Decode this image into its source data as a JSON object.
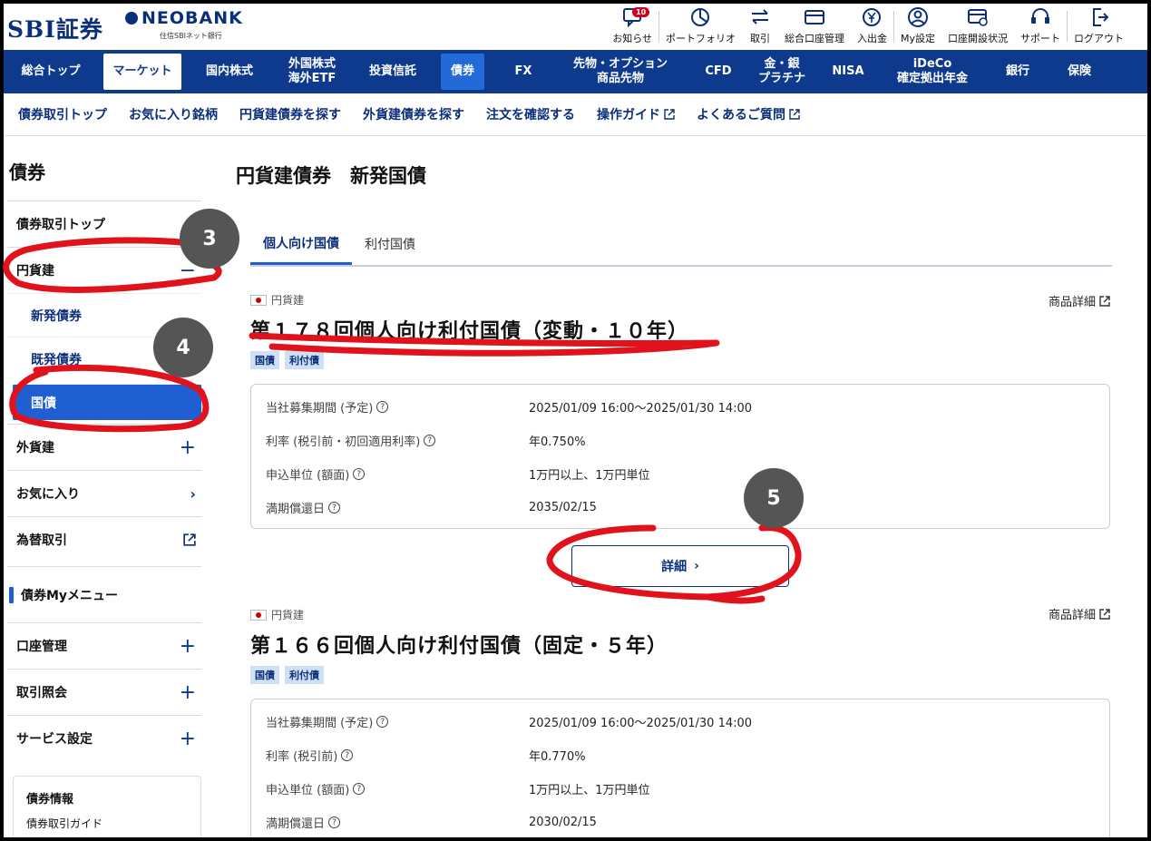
{
  "brand": {
    "sbi": "SBI証券",
    "neobank": "NEOBANK",
    "neobank_sub": "住信SBIネット銀行"
  },
  "topnav": [
    {
      "label": "お知らせ",
      "icon": "message-icon",
      "badge": "10"
    },
    {
      "label": "ポートフォリオ",
      "icon": "pie-chart-icon"
    },
    {
      "label": "取引",
      "icon": "exchange-icon"
    },
    {
      "label": "総合口座管理",
      "icon": "card-icon"
    },
    {
      "label": "入出金",
      "icon": "yen-icon"
    },
    {
      "label": "My設定",
      "icon": "user-icon"
    },
    {
      "label": "口座開設状況",
      "icon": "card-check-icon"
    },
    {
      "label": "サポート",
      "icon": "headset-icon"
    },
    {
      "label": "ログアウト",
      "icon": "logout-icon"
    }
  ],
  "mainnav": [
    "総合トップ",
    "マーケット",
    "国内株式",
    "外国株式\n海外ETF",
    "投資信託",
    "債券",
    "FX",
    "先物・オプション\n商品先物",
    "CFD",
    "金・銀\nプラチナ",
    "NISA",
    "iDeCo\n確定拠出年金",
    "銀行",
    "保険"
  ],
  "subnav": [
    "債券取引トップ",
    "お気に入り銘柄",
    "円貨建債券を探す",
    "外貨建債券を探す",
    "注文を確認する",
    "操作ガイド",
    "よくあるご質問"
  ],
  "sidebar": {
    "title": "債券",
    "top": "債券取引トップ",
    "yen": "円貨建",
    "new_bonds": "新発債券",
    "existing_bonds": "既発債券",
    "jgb": "国債",
    "foreign": "外貨建",
    "favorites": "お気に入り",
    "fx_trade": "為替取引",
    "mymenu": "債券Myメニュー",
    "account": "口座管理",
    "history": "取引照会",
    "service": "サービス設定",
    "info_title": "債券情報",
    "info_link": "債券取引ガイド"
  },
  "page": {
    "title": "円貨建債券　新発国債",
    "tabs": [
      "個人向け国債",
      "利付国債"
    ]
  },
  "bonds": [
    {
      "category": "円貨建",
      "detail_link": "商品詳細",
      "name": "第１７８回個人向け利付国債（変動・１０年）",
      "tags": [
        "国債",
        "利付債"
      ],
      "rows": [
        {
          "k": "当社募集期間 (予定)",
          "v": "2025/01/09 16:00～2025/01/30 14:00"
        },
        {
          "k": "利率 (税引前・初回適用利率)",
          "v": "年0.750%"
        },
        {
          "k": "申込単位 (額面)",
          "v": "1万円以上、1万円単位"
        },
        {
          "k": "満期償還日",
          "v": "2035/02/15"
        }
      ],
      "button": "詳細"
    },
    {
      "category": "円貨建",
      "detail_link": "商品詳細",
      "name": "第１６６回個人向け利付国債（固定・５年）",
      "tags": [
        "国債",
        "利付債"
      ],
      "rows": [
        {
          "k": "当社募集期間 (予定)",
          "v": "2025/01/09 16:00～2025/01/30 14:00"
        },
        {
          "k": "利率 (税引前)",
          "v": "年0.770%"
        },
        {
          "k": "申込単位 (額面)",
          "v": "1万円以上、1万円単位"
        },
        {
          "k": "満期償還日",
          "v": "2030/02/15"
        }
      ]
    }
  ],
  "annotations": {
    "marker3": "3",
    "marker4": "4",
    "marker5": "5",
    "color": "#e0121b"
  },
  "colors": {
    "navy": "#0d3a8c",
    "accent": "#1f5fd1"
  }
}
